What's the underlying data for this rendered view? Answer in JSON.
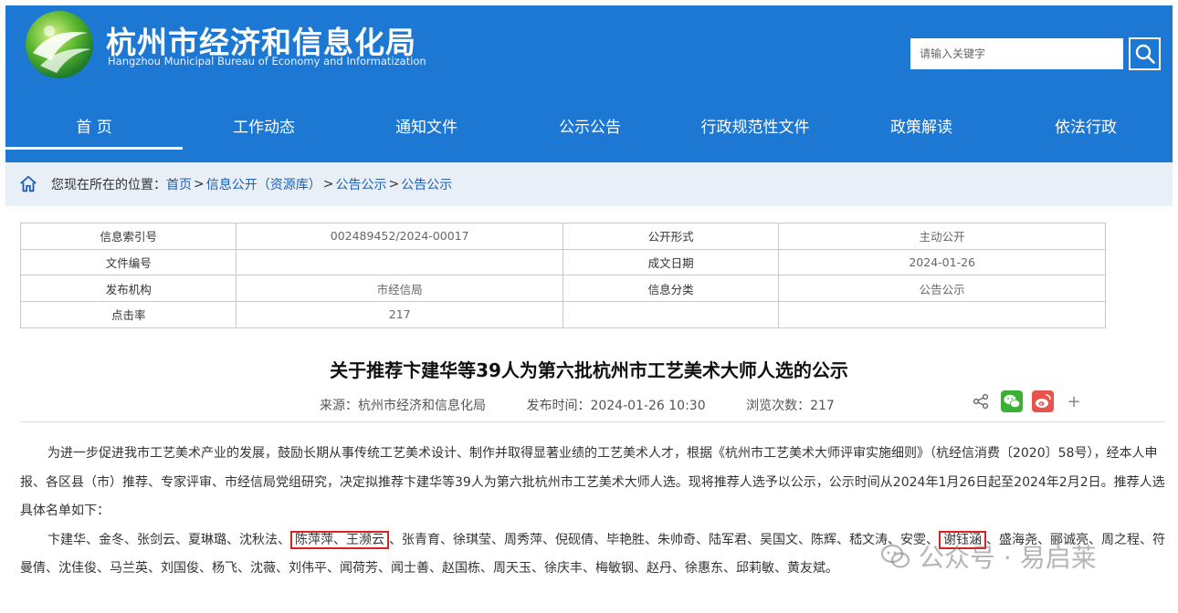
{
  "header": {
    "title": "杭州市经济和信息化局",
    "subtitle": "Hangzhou Municipal Bureau of Economy and Informatization",
    "search_placeholder": "请输入关键字"
  },
  "nav": [
    {
      "label": "首 页",
      "active": true
    },
    {
      "label": "工作动态",
      "active": false
    },
    {
      "label": "通知文件",
      "active": false
    },
    {
      "label": "公示公告",
      "active": false
    },
    {
      "label": "行政规范性文件",
      "active": false
    },
    {
      "label": "政策解读",
      "active": false
    },
    {
      "label": "依法行政",
      "active": false
    }
  ],
  "breadcrumb": {
    "prefix": "您现在所在的位置：",
    "items": [
      "首页",
      "信息公开（资源库）",
      "公告公示",
      "公告公示"
    ],
    "separators": [
      ">",
      ">",
      ">"
    ]
  },
  "info_table": {
    "rows": [
      [
        "信息索引号",
        "002489452/2024-00017",
        "公开形式",
        "主动公开"
      ],
      [
        "文件编号",
        "",
        "成文日期",
        "2024-01-26"
      ],
      [
        "发布机构",
        "市经信局",
        "信息分类",
        "公告公示"
      ],
      [
        "点击率",
        "217",
        "",
        ""
      ]
    ]
  },
  "article": {
    "title": "关于推荐卞建华等39人为第六批杭州市工艺美术大师人选的公示",
    "source": "来源：杭州市经济和信息化局",
    "publish_time": "发布时间：2024-01-26 10:30",
    "views": "浏览次数：217",
    "share_plus": "+",
    "para1": "为进一步促进我市工艺美术产业的发展，鼓励长期从事传统工艺美术设计、制作并取得显著业绩的工艺美术人才，根据《杭州市工艺美术大师评审实施细则》（杭经信消费〔2020〕58号），经本人申报、各区县（市）推荐、专家评审、市经信局党组研究，决定拟推荐卞建华等39人为第六批杭州市工艺美术大师人选。现将推荐人选予以公示，公示时间从2024年1月26日起至2024年2月2日。推荐人选具体名单如下：",
    "names_part1": "卞建华、金冬、张剑云、夏琳璐、沈秋法、",
    "names_hl1": "陈萍萍、王濒云",
    "names_part2": "、张青育、徐琪莹、周秀萍、倪砚倩、毕艳胜、朱帅奇、陆军君、吴国文、陈辉、嵇文涛、安雯、",
    "names_hl2": "谢钰涵",
    "names_part3": "、盛海尧、郦诚亮、周之程、符曼倩、沈佳俊、马兰英、刘国俊、杨飞、沈薇、刘伟平、闻荷芳、闻士善、赵国栋、周天玉、徐庆丰、梅敏钢、赵丹、徐惠东、邱莉敏、黄友斌。"
  },
  "watermark": {
    "text": "公众号 · 易启莱"
  },
  "colors": {
    "header_blue": "#1d78d4",
    "crumb_bg": "#e9eff7",
    "link": "#1d5fb5",
    "highlight_border": "#e02020"
  }
}
